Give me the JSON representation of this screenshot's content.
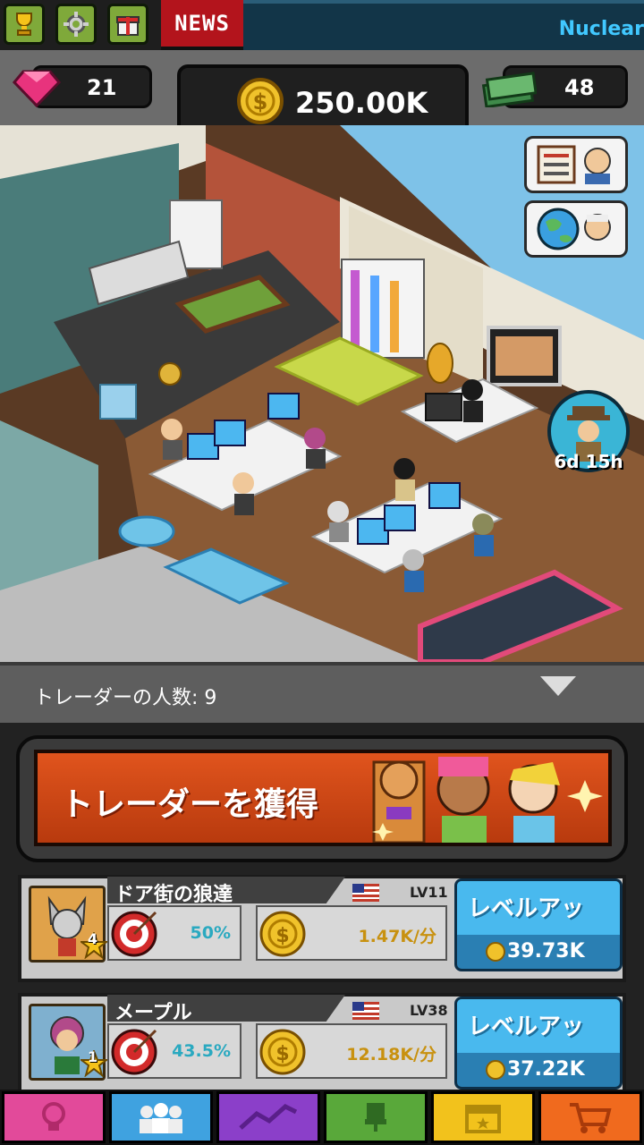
{
  "topbar": {
    "icons": [
      "trophy-icon",
      "gear-icon",
      "gift-icon"
    ],
    "news_label": "NEWS",
    "ticker_text": "Nuclear"
  },
  "resources": {
    "gems": "21",
    "coins": "250.00K",
    "cash": "48"
  },
  "scene": {
    "timer": "6d 15h"
  },
  "traders": {
    "count_label": "トレーダーの人数: 9"
  },
  "hire": {
    "label": "トレーダーを獲得"
  },
  "cards": [
    {
      "name": "ドア街の狼達",
      "level": "LV11",
      "badge": "4",
      "hit_rate": "50%",
      "income": "1.47K/分",
      "button_label": "レベルアッ",
      "cost": "39.73K"
    },
    {
      "name": "メープル",
      "level": "LV38",
      "badge": "1",
      "hit_rate": "43.5%",
      "income": "12.18K/分",
      "button_label": "レベルアッ",
      "cost": "37.22K"
    }
  ],
  "nav": {
    "colors": [
      "#e24a9a",
      "#3fa2e0",
      "#8b3fc9",
      "#59a83a",
      "#f2c21c",
      "#f06a1e"
    ],
    "icons": [
      "lightbulb-icon",
      "traders-icon",
      "chart-icon",
      "chair-icon",
      "calendar-icon",
      "cart-icon"
    ]
  }
}
